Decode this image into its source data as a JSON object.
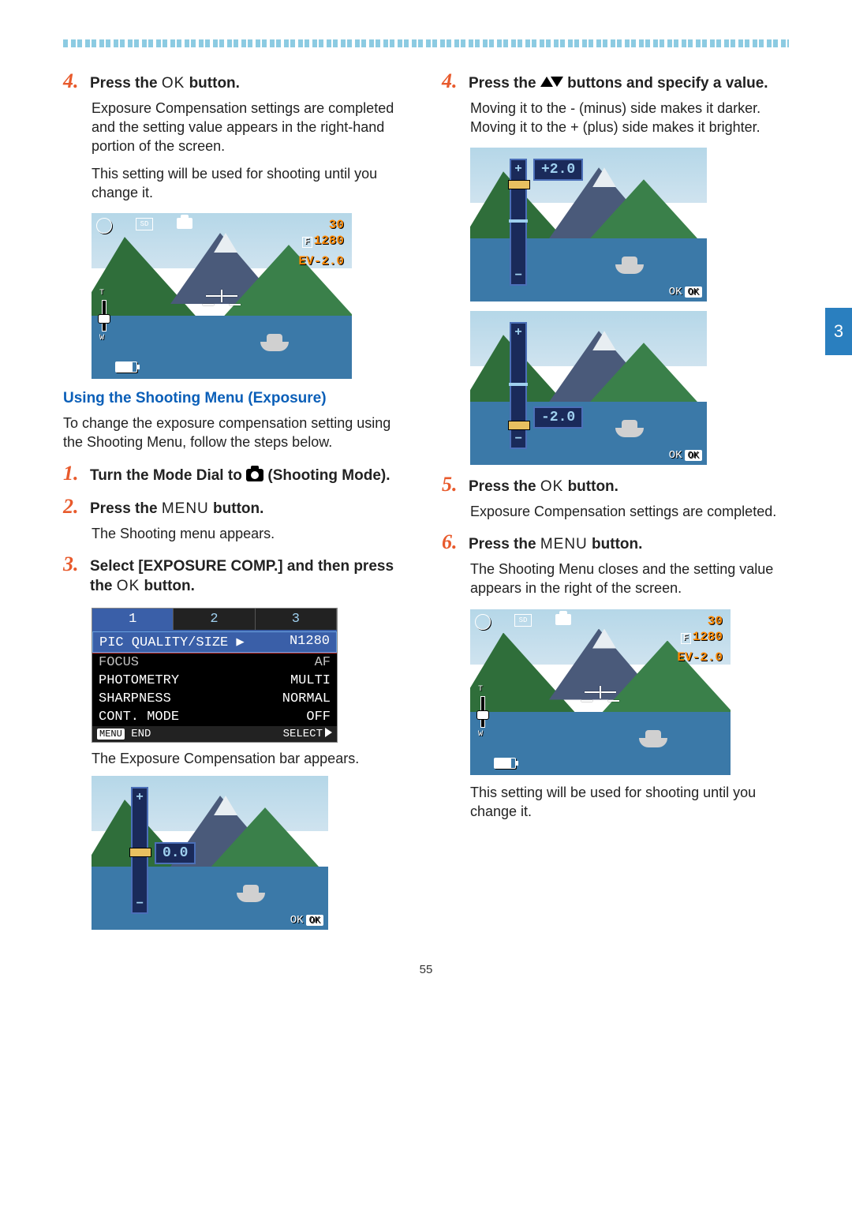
{
  "pageNumber": "55",
  "chapter": "3",
  "left": {
    "step4": {
      "num": "4.",
      "pre": "Press the ",
      "ok": "O",
      "ok2": "K",
      "post": " button.",
      "p1": "Exposure Compensation settings are completed and the setting value appears in the right-hand portion of the screen.",
      "p2": "This setting will be used for shooting until you change it."
    },
    "lcd1": {
      "shots": "30",
      "size": "1280",
      "ev": "EV-2.0"
    },
    "subhead": "Using the Shooting Menu (Exposure)",
    "subtext": "To change the exposure compensation setting using the Shooting Menu, follow the steps below.",
    "step1": {
      "num": "1.",
      "pre": "Turn the Mode Dial to ",
      "post": " (Shooting Mode)."
    },
    "step2": {
      "num": "2.",
      "pre": "Press the ",
      "menu": "M",
      "menu2": "ENU",
      "post": " button.",
      "body": "The Shooting menu appears."
    },
    "step3": {
      "num": "3.",
      "title1": "Select  [EXPOSURE COMP.] and then press the ",
      "ok": "O",
      "ok2": "K",
      "title2": " button.",
      "body": "The Exposure Compensation bar appears."
    },
    "menu": {
      "tabs": [
        "1",
        "2",
        "3"
      ],
      "rows": [
        {
          "l": "PIC QUALITY/SIZE",
          "r": "N1280",
          "hl": true,
          "arrow": true
        },
        {
          "l": "FOCUS",
          "r": "AF",
          "dim": true
        },
        {
          "l": "PHOTOMETRY",
          "r": "MULTI"
        },
        {
          "l": "SHARPNESS",
          "r": "NORMAL"
        },
        {
          "l": "CONT. MODE",
          "r": "OFF"
        }
      ],
      "footL": "MENU",
      "footL2": "END",
      "footR": "SELECT"
    },
    "evbar1": {
      "value": "0.0",
      "ok": "OK",
      "ok2": "OK"
    }
  },
  "right": {
    "step4": {
      "num": "4.",
      "pre": "Press the ",
      "post": " buttons and specify a value.",
      "body": "Moving it to the - (minus) side makes it darker. Moving it to the + (plus) side makes it brighter."
    },
    "evbarPlus": {
      "value": "+2.0",
      "ok": "OK",
      "ok2": "OK"
    },
    "evbarMinus": {
      "value": "-2.0",
      "ok": "OK",
      "ok2": "OK"
    },
    "step5": {
      "num": "5.",
      "pre": "Press the ",
      "ok": "O",
      "ok2": "K",
      "post": " button.",
      "body": "Exposure Compensation settings are completed."
    },
    "step6": {
      "num": "6.",
      "pre": "Press the ",
      "menu": "M",
      "menu2": "ENU",
      "post": " button.",
      "body": "The Shooting Menu closes and the setting value appears in the right of the screen."
    },
    "lcd2": {
      "shots": "30",
      "size": "1280",
      "ev": "EV-2.0"
    },
    "tail": "This setting will be used for shooting until you change it."
  }
}
